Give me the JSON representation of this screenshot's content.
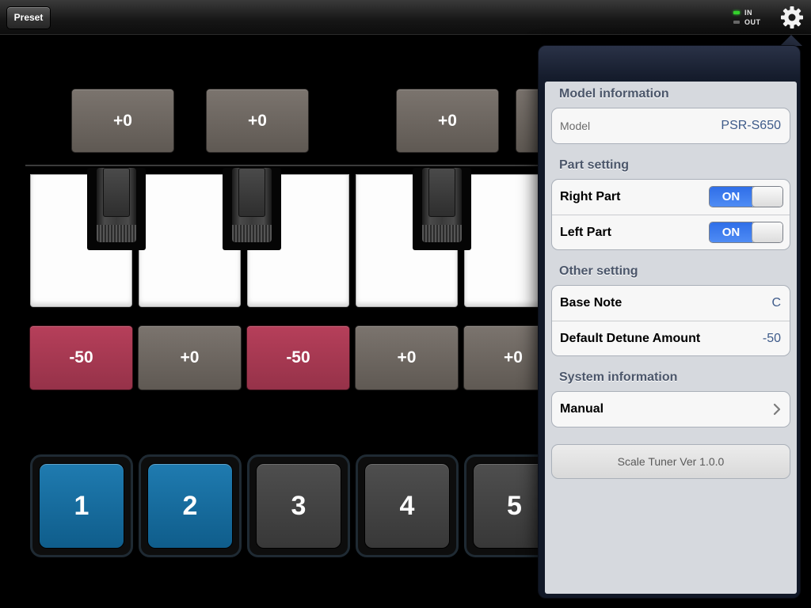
{
  "topbar": {
    "preset_label": "Preset",
    "io": {
      "in_label": "IN",
      "out_label": "OUT",
      "in_led_color": "#34d12c",
      "out_led_color": "#666666"
    },
    "settings_icon": "gear-icon"
  },
  "top_tiles": [
    "+0",
    "+0",
    "+0",
    ""
  ],
  "bottom_tiles": [
    {
      "label": "-50",
      "style": "red"
    },
    {
      "label": "+0",
      "style": "gray"
    },
    {
      "label": "-50",
      "style": "red"
    },
    {
      "label": "+0",
      "style": "gray"
    },
    {
      "label": "+0",
      "style": "gray"
    }
  ],
  "number_buttons": [
    {
      "label": "1",
      "active": true
    },
    {
      "label": "2",
      "active": true
    },
    {
      "label": "3",
      "active": false
    },
    {
      "label": "4",
      "active": false
    },
    {
      "label": "5",
      "active": false
    }
  ],
  "colors": {
    "active_blue": "#1a6fa3",
    "detune_red": "#a8394f",
    "tile_gray": "#6e6862",
    "switch_blue": "#3a7ef0",
    "section_title": "#4b566a"
  },
  "popover": {
    "model_info": {
      "title": "Model information",
      "model_label": "Model",
      "model_value": "PSR-S650"
    },
    "part_setting": {
      "title": "Part setting",
      "right_part_label": "Right Part",
      "right_part_state": "ON",
      "left_part_label": "Left Part",
      "left_part_state": "ON"
    },
    "other_setting": {
      "title": "Other setting",
      "base_note_label": "Base Note",
      "base_note_value": "C",
      "detune_label": "Default Detune Amount",
      "detune_value": "-50"
    },
    "system_info": {
      "title": "System information",
      "manual_label": "Manual",
      "manual_icon": "chevron-right-icon"
    },
    "version": "Scale Tuner Ver 1.0.0"
  }
}
